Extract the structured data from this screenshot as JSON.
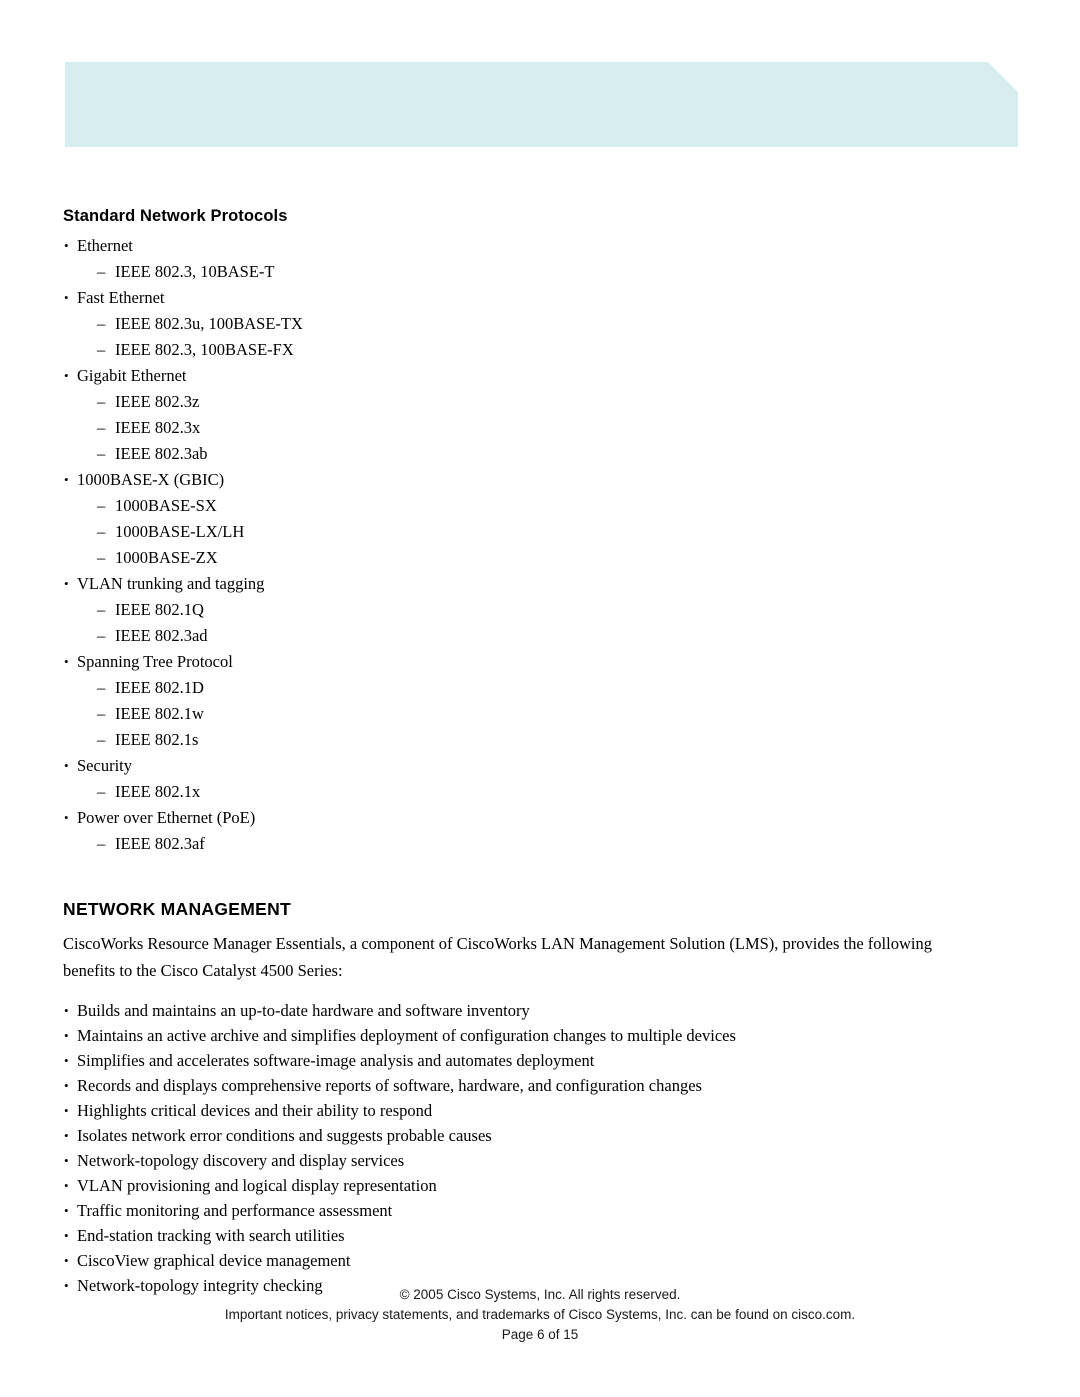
{
  "banner": {
    "color": "#d7eef0",
    "name": "header-banner"
  },
  "protocols": {
    "heading": "Standard Network Protocols",
    "groups": [
      {
        "label": "Ethernet",
        "items": [
          "IEEE 802.3, 10BASE-T"
        ]
      },
      {
        "label": "Fast Ethernet",
        "items": [
          "IEEE 802.3u, 100BASE-TX",
          "IEEE 802.3, 100BASE-FX"
        ]
      },
      {
        "label": "Gigabit Ethernet",
        "items": [
          "IEEE 802.3z",
          "IEEE 802.3x",
          "IEEE 802.3ab"
        ]
      },
      {
        "label": "1000BASE-X (GBIC)",
        "items": [
          "1000BASE-SX",
          "1000BASE-LX/LH",
          "1000BASE-ZX"
        ]
      },
      {
        "label": "VLAN trunking and tagging",
        "items": [
          "IEEE 802.1Q",
          "IEEE 802.3ad"
        ]
      },
      {
        "label": "Spanning Tree Protocol",
        "items": [
          "IEEE 802.1D",
          "IEEE 802.1w",
          "IEEE 802.1s"
        ]
      },
      {
        "label": "Security",
        "items": [
          "IEEE 802.1x"
        ]
      },
      {
        "label": "Power over Ethernet (PoE)",
        "items": [
          "IEEE 802.3af"
        ]
      }
    ]
  },
  "network_management": {
    "heading": "NETWORK MANAGEMENT",
    "paragraph": "CiscoWorks Resource Manager Essentials, a component of CiscoWorks LAN Management Solution (LMS), provides the following benefits to the Cisco Catalyst 4500 Series:",
    "benefits": [
      "Builds and maintains an up-to-date hardware and software inventory",
      "Maintains an active archive and simplifies deployment of configuration changes to multiple devices",
      "Simplifies and accelerates software-image analysis and automates deployment",
      "Records and displays comprehensive reports of software, hardware, and configuration changes",
      "Highlights critical devices and their ability to respond",
      "Isolates network error conditions and suggests probable causes",
      "Network-topology discovery and display services",
      "VLAN provisioning and logical display representation",
      "Traffic monitoring and performance assessment",
      "End-station tracking with search utilities",
      "CiscoView graphical device management",
      "Network-topology integrity checking"
    ]
  },
  "bullet_glyphs": {
    "dot": "•",
    "dash": "–"
  },
  "footer": {
    "copyright": "© 2005 Cisco Systems, Inc. All rights reserved.",
    "notice": "Important notices, privacy statements, and trademarks of Cisco Systems, Inc. can be found on cisco.com.",
    "page": "Page 6 of 15"
  }
}
